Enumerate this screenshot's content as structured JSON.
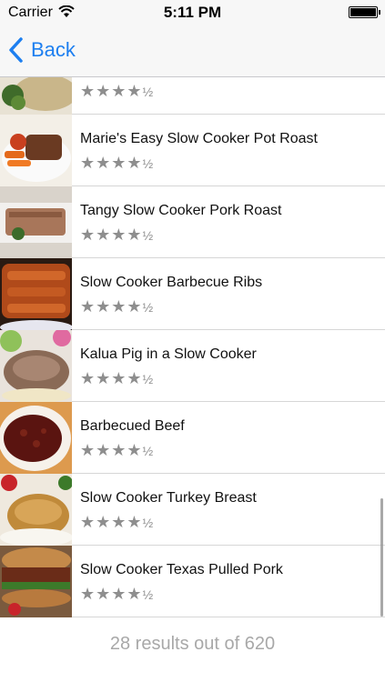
{
  "status_bar": {
    "carrier": "Carrier",
    "time": "5:11 PM"
  },
  "nav": {
    "back_label": "Back"
  },
  "rows": [
    {
      "title": "",
      "rating": "★★★★",
      "half": "½"
    },
    {
      "title": "Marie's Easy Slow Cooker Pot Roast",
      "rating": "★★★★",
      "half": "½"
    },
    {
      "title": "Tangy Slow Cooker Pork Roast",
      "rating": "★★★★",
      "half": "½"
    },
    {
      "title": "Slow Cooker Barbecue Ribs",
      "rating": "★★★★",
      "half": "½"
    },
    {
      "title": "Kalua Pig in a Slow Cooker",
      "rating": "★★★★",
      "half": "½"
    },
    {
      "title": "Barbecued Beef",
      "rating": "★★★★",
      "half": "½"
    },
    {
      "title": "Slow Cooker Turkey Breast",
      "rating": "★★★★",
      "half": "½"
    },
    {
      "title": "Slow Cooker Texas Pulled Pork",
      "rating": "★★★★",
      "half": "½"
    }
  ],
  "footer": {
    "results_text": "28 results out of 620"
  },
  "colors": {
    "accent": "#1d7ff0",
    "star": "#8e8e8e",
    "footer_text": "#a8a8a8"
  }
}
